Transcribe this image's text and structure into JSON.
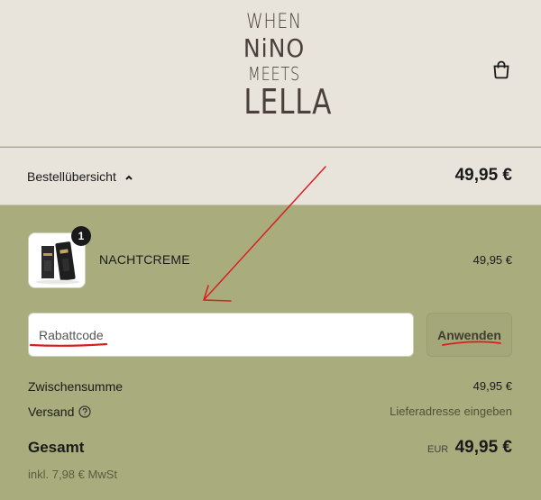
{
  "brand": {
    "logo_lines": [
      "WHEN",
      "NiNO",
      "MEETS",
      "LELLA"
    ]
  },
  "header": {
    "cart_icon": "shopping-bag-icon"
  },
  "summary": {
    "label": "Bestellübersicht",
    "toggle_icon": "chevron-up-icon",
    "total": "49,95 €"
  },
  "cart_item": {
    "quantity": "1",
    "name": "NACHTCREME",
    "price": "49,95 €"
  },
  "discount": {
    "placeholder": "Rabattcode",
    "apply_label": "Anwenden"
  },
  "totals": {
    "subtotal_label": "Zwischensumme",
    "subtotal_value": "49,95 €",
    "shipping_label": "Versand",
    "shipping_value": "Lieferadresse eingeben",
    "total_label": "Gesamt",
    "currency": "EUR",
    "total_value": "49,95 €",
    "tax_note": "inkl. 7,98 € MwSt"
  },
  "colors": {
    "header_bg": "#e8e4dc",
    "main_bg": "#a9ad7d",
    "annotation_red": "#d62020"
  }
}
